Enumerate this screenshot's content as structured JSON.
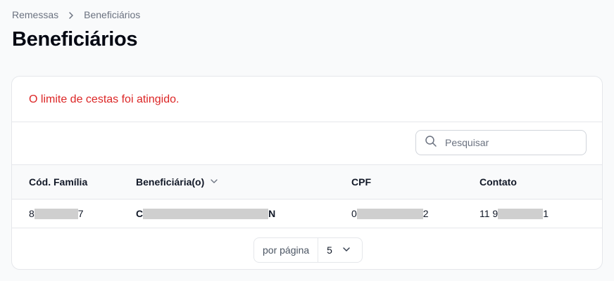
{
  "breadcrumb": {
    "items": [
      "Remessas",
      "Beneficiários"
    ]
  },
  "page": {
    "title": "Beneficiários"
  },
  "alert": {
    "message": "O limite de cestas foi atingido."
  },
  "search": {
    "placeholder": "Pesquisar",
    "value": ""
  },
  "table": {
    "headers": {
      "family_code": "Cód. Família",
      "beneficiary": "Beneficiária(o)",
      "cpf": "CPF",
      "contact": "Contato"
    },
    "rows": [
      {
        "family_code_start": "8",
        "family_code_end": "7",
        "beneficiary_start": "C",
        "beneficiary_end": "N",
        "cpf_start": "0",
        "cpf_end": "2",
        "contact_start": "11 9",
        "contact_end": "1"
      }
    ]
  },
  "pagination": {
    "per_page_label": "por página",
    "per_page_value": "5"
  },
  "colors": {
    "alert": "#dc2626",
    "border": "#e5e7eb",
    "header_bg": "#f9fafb",
    "redaction": "#cfcfcf"
  }
}
